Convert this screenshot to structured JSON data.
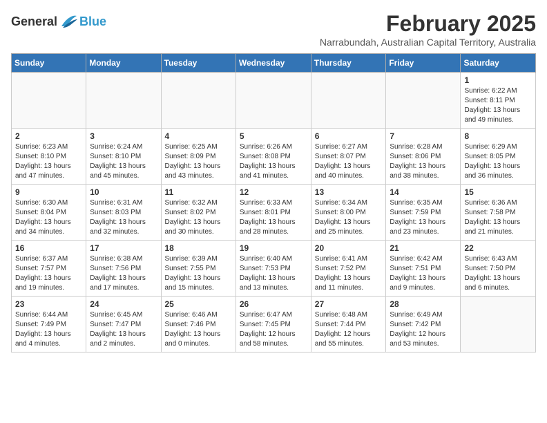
{
  "header": {
    "logo_general": "General",
    "logo_blue": "Blue",
    "month_title": "February 2025",
    "subtitle": "Narrabundah, Australian Capital Territory, Australia"
  },
  "weekdays": [
    "Sunday",
    "Monday",
    "Tuesday",
    "Wednesday",
    "Thursday",
    "Friday",
    "Saturday"
  ],
  "weeks": [
    [
      {
        "day": "",
        "info": ""
      },
      {
        "day": "",
        "info": ""
      },
      {
        "day": "",
        "info": ""
      },
      {
        "day": "",
        "info": ""
      },
      {
        "day": "",
        "info": ""
      },
      {
        "day": "",
        "info": ""
      },
      {
        "day": "1",
        "info": "Sunrise: 6:22 AM\nSunset: 8:11 PM\nDaylight: 13 hours and 49 minutes."
      }
    ],
    [
      {
        "day": "2",
        "info": "Sunrise: 6:23 AM\nSunset: 8:10 PM\nDaylight: 13 hours and 47 minutes."
      },
      {
        "day": "3",
        "info": "Sunrise: 6:24 AM\nSunset: 8:10 PM\nDaylight: 13 hours and 45 minutes."
      },
      {
        "day": "4",
        "info": "Sunrise: 6:25 AM\nSunset: 8:09 PM\nDaylight: 13 hours and 43 minutes."
      },
      {
        "day": "5",
        "info": "Sunrise: 6:26 AM\nSunset: 8:08 PM\nDaylight: 13 hours and 41 minutes."
      },
      {
        "day": "6",
        "info": "Sunrise: 6:27 AM\nSunset: 8:07 PM\nDaylight: 13 hours and 40 minutes."
      },
      {
        "day": "7",
        "info": "Sunrise: 6:28 AM\nSunset: 8:06 PM\nDaylight: 13 hours and 38 minutes."
      },
      {
        "day": "8",
        "info": "Sunrise: 6:29 AM\nSunset: 8:05 PM\nDaylight: 13 hours and 36 minutes."
      }
    ],
    [
      {
        "day": "9",
        "info": "Sunrise: 6:30 AM\nSunset: 8:04 PM\nDaylight: 13 hours and 34 minutes."
      },
      {
        "day": "10",
        "info": "Sunrise: 6:31 AM\nSunset: 8:03 PM\nDaylight: 13 hours and 32 minutes."
      },
      {
        "day": "11",
        "info": "Sunrise: 6:32 AM\nSunset: 8:02 PM\nDaylight: 13 hours and 30 minutes."
      },
      {
        "day": "12",
        "info": "Sunrise: 6:33 AM\nSunset: 8:01 PM\nDaylight: 13 hours and 28 minutes."
      },
      {
        "day": "13",
        "info": "Sunrise: 6:34 AM\nSunset: 8:00 PM\nDaylight: 13 hours and 25 minutes."
      },
      {
        "day": "14",
        "info": "Sunrise: 6:35 AM\nSunset: 7:59 PM\nDaylight: 13 hours and 23 minutes."
      },
      {
        "day": "15",
        "info": "Sunrise: 6:36 AM\nSunset: 7:58 PM\nDaylight: 13 hours and 21 minutes."
      }
    ],
    [
      {
        "day": "16",
        "info": "Sunrise: 6:37 AM\nSunset: 7:57 PM\nDaylight: 13 hours and 19 minutes."
      },
      {
        "day": "17",
        "info": "Sunrise: 6:38 AM\nSunset: 7:56 PM\nDaylight: 13 hours and 17 minutes."
      },
      {
        "day": "18",
        "info": "Sunrise: 6:39 AM\nSunset: 7:55 PM\nDaylight: 13 hours and 15 minutes."
      },
      {
        "day": "19",
        "info": "Sunrise: 6:40 AM\nSunset: 7:53 PM\nDaylight: 13 hours and 13 minutes."
      },
      {
        "day": "20",
        "info": "Sunrise: 6:41 AM\nSunset: 7:52 PM\nDaylight: 13 hours and 11 minutes."
      },
      {
        "day": "21",
        "info": "Sunrise: 6:42 AM\nSunset: 7:51 PM\nDaylight: 13 hours and 9 minutes."
      },
      {
        "day": "22",
        "info": "Sunrise: 6:43 AM\nSunset: 7:50 PM\nDaylight: 13 hours and 6 minutes."
      }
    ],
    [
      {
        "day": "23",
        "info": "Sunrise: 6:44 AM\nSunset: 7:49 PM\nDaylight: 13 hours and 4 minutes."
      },
      {
        "day": "24",
        "info": "Sunrise: 6:45 AM\nSunset: 7:47 PM\nDaylight: 13 hours and 2 minutes."
      },
      {
        "day": "25",
        "info": "Sunrise: 6:46 AM\nSunset: 7:46 PM\nDaylight: 13 hours and 0 minutes."
      },
      {
        "day": "26",
        "info": "Sunrise: 6:47 AM\nSunset: 7:45 PM\nDaylight: 12 hours and 58 minutes."
      },
      {
        "day": "27",
        "info": "Sunrise: 6:48 AM\nSunset: 7:44 PM\nDaylight: 12 hours and 55 minutes."
      },
      {
        "day": "28",
        "info": "Sunrise: 6:49 AM\nSunset: 7:42 PM\nDaylight: 12 hours and 53 minutes."
      },
      {
        "day": "",
        "info": ""
      }
    ]
  ]
}
